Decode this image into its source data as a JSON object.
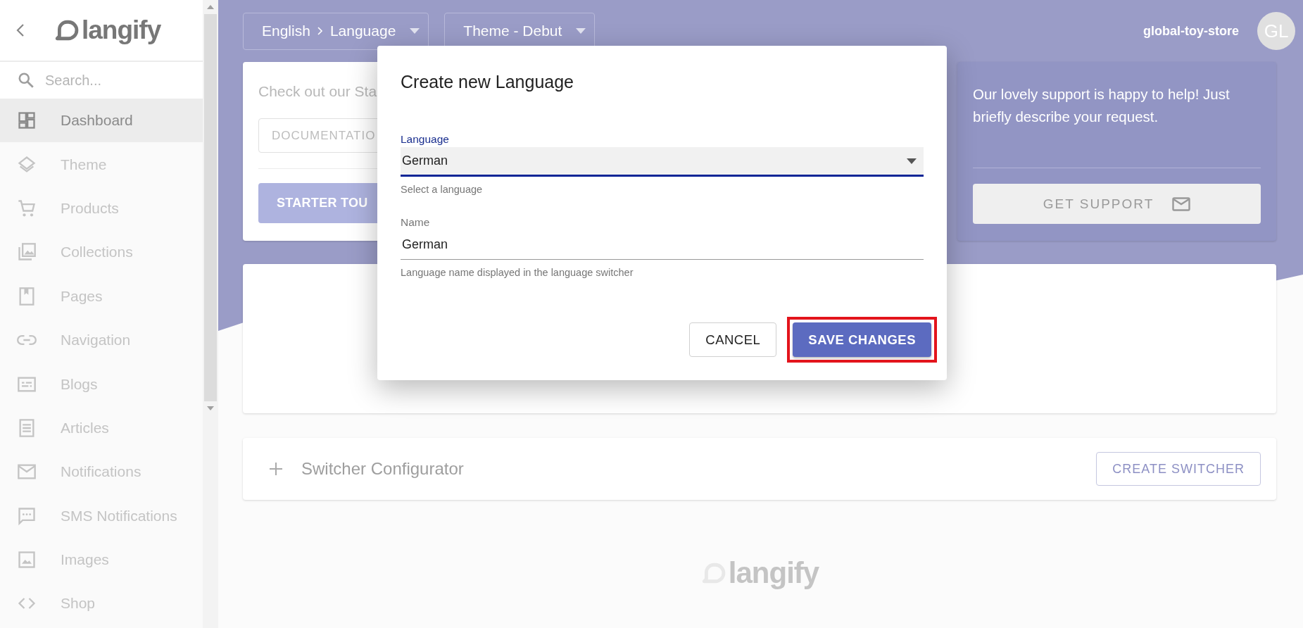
{
  "sidebar": {
    "logo": "langify",
    "search": {
      "placeholder": "Search..."
    },
    "items": [
      {
        "label": "Dashboard",
        "selected": true
      },
      {
        "label": "Theme",
        "selected": false
      },
      {
        "label": "Products",
        "selected": false
      },
      {
        "label": "Collections",
        "selected": false
      },
      {
        "label": "Pages",
        "selected": false
      },
      {
        "label": "Navigation",
        "selected": false
      },
      {
        "label": "Blogs",
        "selected": false
      },
      {
        "label": "Articles",
        "selected": false
      },
      {
        "label": "Notifications",
        "selected": false
      },
      {
        "label": "SMS Notifications",
        "selected": false
      },
      {
        "label": "Images",
        "selected": false
      },
      {
        "label": "Shop",
        "selected": false
      }
    ]
  },
  "topbar": {
    "dropdowns": [
      {
        "parts": [
          "English",
          "Language"
        ]
      },
      {
        "parts": [
          "Theme - Debut"
        ]
      }
    ],
    "store": "global-toy-store",
    "avatar": "GL"
  },
  "start_card": {
    "text": "Check out our Sta",
    "buttons": [
      {
        "label": "DOCUMENTATIO",
        "kind": "outlined"
      },
      {
        "label": "STARTER TOU",
        "kind": "filled"
      }
    ]
  },
  "support_card": {
    "text": "Our lovely support is happy to help! Just briefly describe your request.",
    "button": "GET SUPPORT"
  },
  "switcher": {
    "title": "Switcher Configurator",
    "button": "CREATE SWITCHER"
  },
  "footer": {
    "logo": "langify"
  },
  "dialog": {
    "title": "Create new Language",
    "fields": [
      {
        "kind": "select",
        "label": "Language",
        "value": "German",
        "helper": "Select a language",
        "focused": true
      },
      {
        "kind": "text",
        "label": "Name",
        "value": "German",
        "helper": "Language name displayed in the language switcher",
        "focused": false
      }
    ],
    "buttons": [
      {
        "label": "CANCEL",
        "kind": "outlined",
        "highlighted": false
      },
      {
        "label": "SAVE CHANGES",
        "kind": "filled",
        "highlighted": true
      }
    ]
  }
}
